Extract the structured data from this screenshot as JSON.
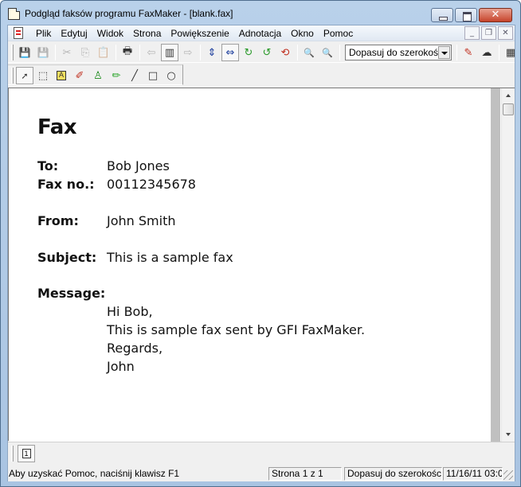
{
  "window": {
    "title": "Podgląd faksów programu FaxMaker - [blank.fax]",
    "caption_buttons": {
      "minimize": "minimize",
      "maximize": "maximize",
      "close": "✕"
    }
  },
  "menubar": {
    "items": [
      "Plik",
      "Edytuj",
      "Widok",
      "Strona",
      "Powiększenie",
      "Adnotacja",
      "Okno",
      "Pomoc"
    ],
    "mdi_buttons": {
      "minimize": "_",
      "restore": "❐",
      "close": "✕"
    }
  },
  "toolbar": {
    "icons": {
      "save": "💾",
      "save_as": "💾",
      "cut": "✂",
      "copy": "⎘",
      "paste": "📋",
      "print": "🖶",
      "prev_page": "⇦",
      "page_view": "▥",
      "next_page": "⇨",
      "fit_height": "⇕",
      "fit_width": "⇔",
      "rotate_cw": "↻",
      "rotate_ccw": "↺",
      "flip": "⟲",
      "zoom_out": "🔍",
      "zoom_in": "🔍",
      "annotate": "✎",
      "lasso": "☁",
      "thumbnails": "▦"
    },
    "zoom_select": {
      "value": "Dopasuj do szerokości"
    }
  },
  "annotation_toolbar": {
    "icons": {
      "pointer": "➚",
      "select_rect": "⬚",
      "text": "A",
      "highlighter": "✐",
      "stamp": "♙",
      "pen": "✏",
      "line": "╱",
      "rectangle": "□",
      "ellipse": "○"
    }
  },
  "document": {
    "title": "Fax",
    "fields": [
      {
        "label": "To:",
        "value": "Bob Jones"
      },
      {
        "label": "Fax no.:",
        "value": "00112345678"
      },
      {
        "label": "From:",
        "value": "John Smith"
      },
      {
        "label": "Subject:",
        "value": "This is a sample fax"
      },
      {
        "label": "Message:",
        "value": ""
      }
    ],
    "message_lines": [
      "Hi Bob,",
      "This is sample fax sent by GFI FaxMaker.",
      "Regards,",
      "John"
    ]
  },
  "page_tabs": {
    "current": "1"
  },
  "statusbar": {
    "help": "Aby uzyskać Pomoc, naciśnij klawisz F1",
    "page": "Strona 1 z 1",
    "zoom": "Dopasuj do szerokości",
    "datetime": "11/16/11 03:0"
  }
}
